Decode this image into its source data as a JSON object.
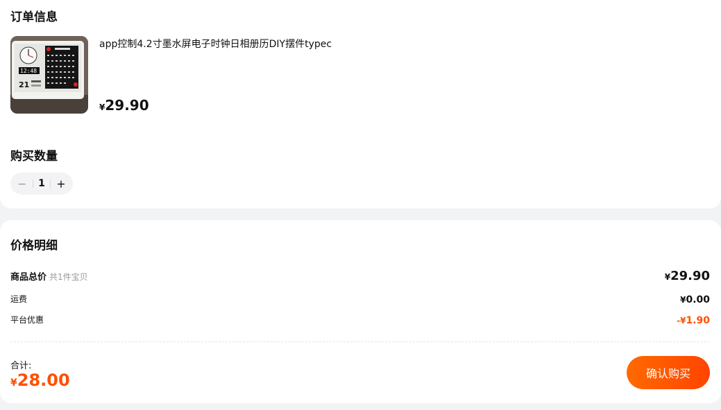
{
  "order": {
    "title": "订单信息",
    "product": {
      "image_icon": "e-ink-calendar-clock-photo",
      "name": "app控制4.2寸墨水屏电子时钟日相册历DIY摆件typec",
      "price_currency": "¥",
      "price_value": "29.90"
    }
  },
  "quantity": {
    "title": "购买数量",
    "value": "1",
    "minus_label": "−",
    "plus_label": "+"
  },
  "price_detail": {
    "title": "价格明细",
    "goods_total": {
      "label": "商品总价",
      "sub": "共1件宝贝",
      "currency": "¥",
      "value": "29.90"
    },
    "shipping": {
      "label": "运费",
      "currency": "¥",
      "value": "0.00"
    },
    "platform_discount": {
      "label": "平台优惠",
      "prefix": "-¥",
      "value": "1.90"
    },
    "total": {
      "label": "合计:",
      "currency": "¥",
      "value": "28.00"
    },
    "confirm_label": "确认购买"
  },
  "colors": {
    "accent": "#ff5000",
    "button_gradient_start": "#ff6a00",
    "button_gradient_end": "#ff4400",
    "page_bg": "#f2f3f5"
  }
}
